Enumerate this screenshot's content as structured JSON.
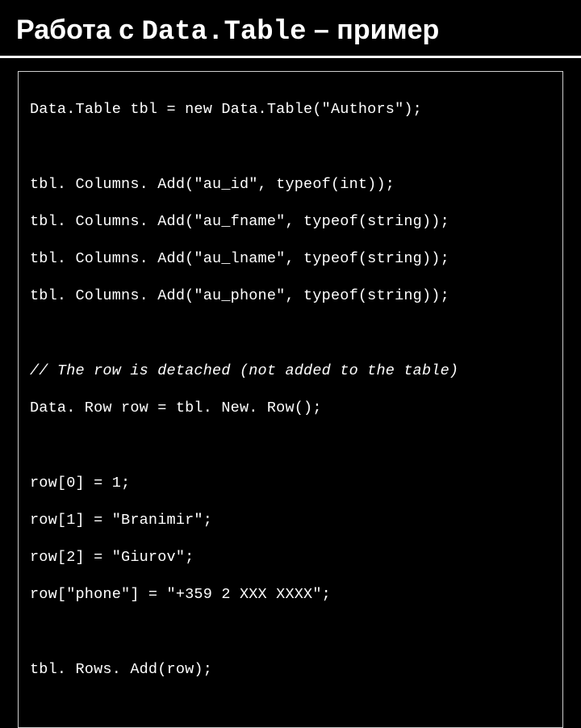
{
  "title": {
    "prefix": "Работа с ",
    "mono": "Data.Table",
    "suffix": " – пример"
  },
  "code": {
    "l1": "Data.Table tbl = new Data.Table(\"Authors\");",
    "l2": "tbl. Columns. Add(\"au_id\", typeof(int));",
    "l3": "tbl. Columns. Add(\"au_fname\", typeof(string));",
    "l4": "tbl. Columns. Add(\"au_lname\", typeof(string));",
    "l5": "tbl. Columns. Add(\"au_phone\", typeof(string));",
    "l6": "// The row is detached (not added to the table)",
    "l7": "Data. Row row = tbl. New. Row();",
    "l8": "row[0] = 1;",
    "l9": "row[1] = \"Branimir\";",
    "l10": "row[2] = \"Giurov\";",
    "l11": "row[\"phone\"] = \"+359 2 XXX XXXX\";",
    "l12": "tbl. Rows. Add(row);"
  }
}
